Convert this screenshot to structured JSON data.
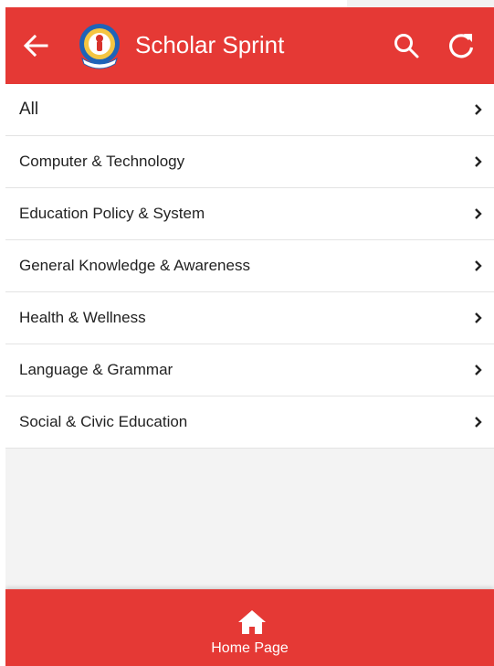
{
  "app": {
    "title": "Scholar Sprint",
    "accent_color": "#e53935"
  },
  "header": {
    "back_icon": "arrow-left-icon",
    "logo": "app-logo",
    "search_icon": "search-icon",
    "refresh_icon": "refresh-icon"
  },
  "categories": [
    {
      "label": "All"
    },
    {
      "label": "Computer & Technology"
    },
    {
      "label": "Education Policy & System"
    },
    {
      "label": "General Knowledge & Awareness"
    },
    {
      "label": "Health & Wellness"
    },
    {
      "label": "Language & Grammar"
    },
    {
      "label": "Social & Civic Education"
    }
  ],
  "bottom_nav": {
    "icon": "home-icon",
    "label": "Home Page"
  }
}
